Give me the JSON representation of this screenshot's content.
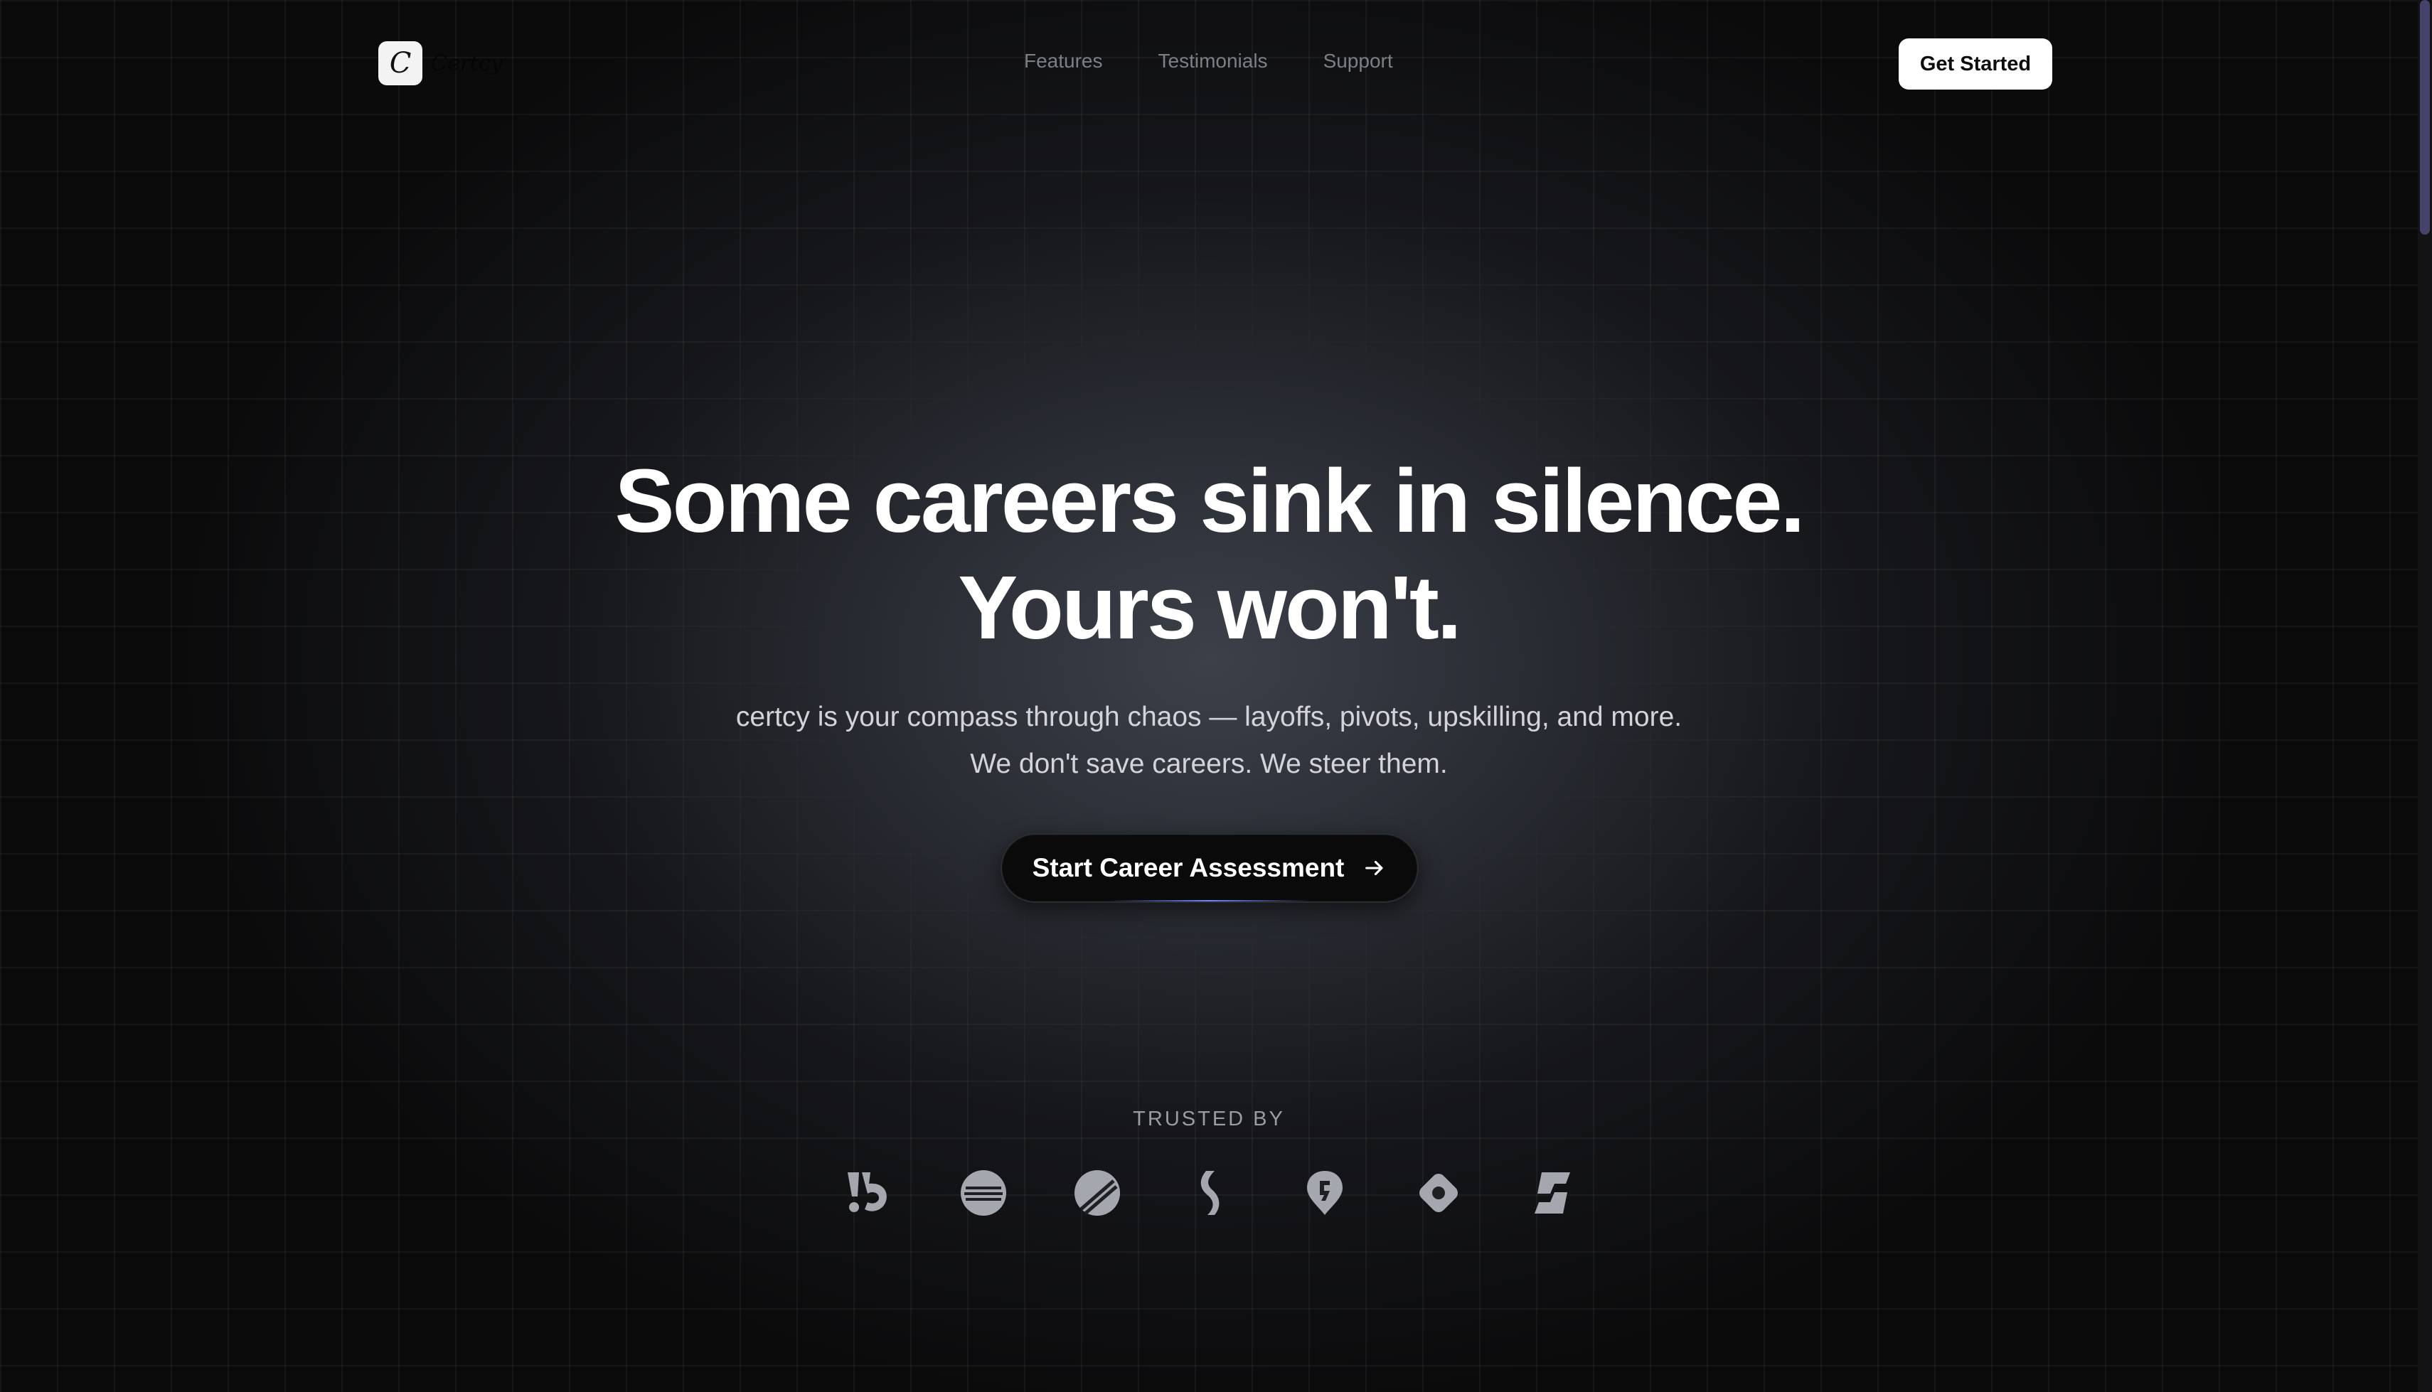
{
  "brand": {
    "logo_letter": "C",
    "name": "Certcy"
  },
  "nav": {
    "links": [
      {
        "label": "Features"
      },
      {
        "label": "Testimonials"
      },
      {
        "label": "Support"
      }
    ],
    "cta_label": "Get Started"
  },
  "hero": {
    "headline_line1": "Some careers sink in silence.",
    "headline_line2": "Yours won't.",
    "subtext": "certcy is your compass through chaos — layoffs, pivots, upskilling, and more. We don't save careers. We steer them.",
    "cta_label": "Start Career Assessment",
    "cta_icon": "arrow-right-icon"
  },
  "trusted": {
    "label": "TRUSTED BY",
    "logos": [
      "brand-logo-1",
      "brand-logo-2",
      "brand-logo-3",
      "brand-logo-4",
      "brand-logo-5",
      "brand-logo-6",
      "brand-logo-7"
    ]
  },
  "colors": {
    "background": "#0b0b0c",
    "accent_glow": "#6f86ff",
    "muted_text": "#7d7f85",
    "logo_gray": "#a4a7ad"
  }
}
